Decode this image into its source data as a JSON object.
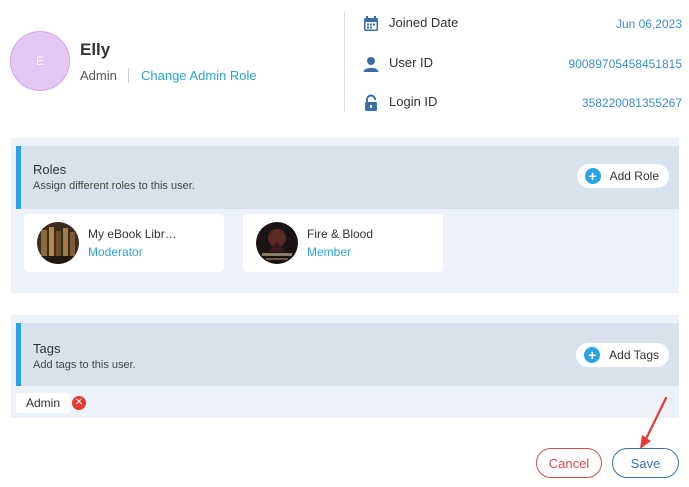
{
  "profile": {
    "avatar_initial": "E",
    "name": "Elly",
    "role": "Admin",
    "change_role_label": "Change Admin Role"
  },
  "info": [
    {
      "label": "Joined Date",
      "value": "Jun 06,2023",
      "icon": "calendar-icon"
    },
    {
      "label": "User ID",
      "value": "90089705458451815",
      "icon": "user-icon"
    },
    {
      "label": "Login ID",
      "value": "358220081355267",
      "icon": "lock-icon"
    }
  ],
  "roles": {
    "title": "Roles",
    "subtitle": "Assign different roles to this user.",
    "add_label": "Add Role",
    "items": [
      {
        "name": "My eBook Libr…",
        "permission": "Moderator"
      },
      {
        "name": "Fire & Blood",
        "permission": "Member"
      }
    ]
  },
  "tags": {
    "title": "Tags",
    "subtitle": "Add tags to this user.",
    "add_label": "Add Tags",
    "items": [
      "Admin"
    ]
  },
  "footer": {
    "cancel_label": "Cancel",
    "save_label": "Save"
  },
  "colors": {
    "accent": "#2ba3e4",
    "link": "#2aa5d6",
    "danger": "#d94a4a",
    "save": "#3f6fae",
    "annotation_arrow": "#e53935"
  }
}
